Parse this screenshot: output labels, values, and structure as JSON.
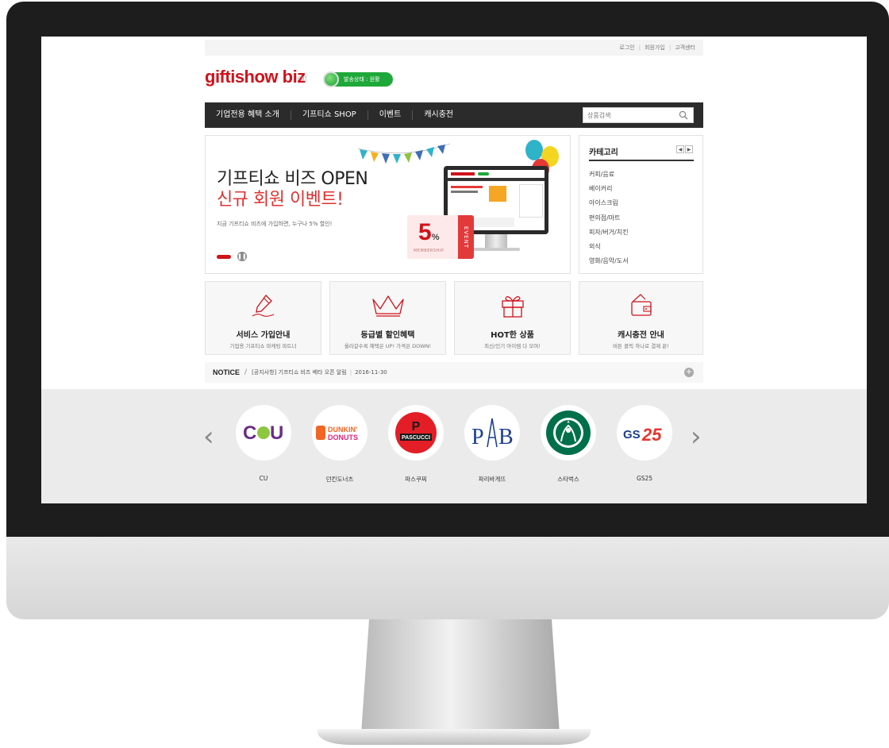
{
  "util_links": [
    "로그인",
    "회원가입",
    "고객센터"
  ],
  "logo": {
    "text": "giftishow biz",
    "badge": "CBT"
  },
  "status": {
    "label": "발송상태 : 원활"
  },
  "nav": {
    "items": [
      "기업전용 혜택 소개",
      "기프티쇼 SHOP",
      "이벤트",
      "캐시충전"
    ],
    "search_placeholder": "상품검색"
  },
  "banner": {
    "title_line1": "기프티쇼 비즈 OPEN",
    "title_line2": "신규 회원 이벤트!",
    "description": "지금 기프티쇼 비즈에 가입하면, 누구나 5% 할인!",
    "coupon_value": "5",
    "coupon_unit": "%",
    "coupon_label": "MEMBERSHIP",
    "coupon_side": "EVENT"
  },
  "category": {
    "title": "카테고리",
    "items": [
      "커피/음료",
      "베이커리",
      "아이스크림",
      "편의점/마트",
      "피자/버거/치킨",
      "외식",
      "영화/음악/도서"
    ]
  },
  "services": [
    {
      "title": "서비스 가입안내",
      "subtitle": "기업용 기프티쇼 마케팅 파트너",
      "icon": "pen-icon"
    },
    {
      "title": "등급별 할인혜택",
      "subtitle": "올라갈수록 혜택은 UP! 가격은 DOWN!",
      "icon": "crown-icon"
    },
    {
      "title": "HOT한 상품",
      "subtitle": "최신/인기 아이템 다 모여!",
      "icon": "gift-icon"
    },
    {
      "title": "캐시충전 안내",
      "subtitle": "버튼 클릭 하나로 결제 끝!",
      "icon": "wallet-icon"
    }
  ],
  "notice": {
    "label": "NOTICE",
    "text": "[공지사항] 기프티쇼 비즈 베타 오픈 알림",
    "date": "2016-11-30"
  },
  "brands": [
    {
      "name": "CU",
      "logo": "CU"
    },
    {
      "name": "던킨도너츠",
      "logo": "DUNKIN' DONUTS"
    },
    {
      "name": "파스쿠찌",
      "logo": "PASCUCCI"
    },
    {
      "name": "파리바게뜨",
      "logo": "PB"
    },
    {
      "name": "스타벅스",
      "logo": "starbucks-logo"
    },
    {
      "name": "GS25",
      "logo": "GS25"
    }
  ],
  "colors": {
    "brand_red": "#d0121b",
    "status_green": "#1fa83a",
    "nav_bg": "#2b2b2b"
  }
}
